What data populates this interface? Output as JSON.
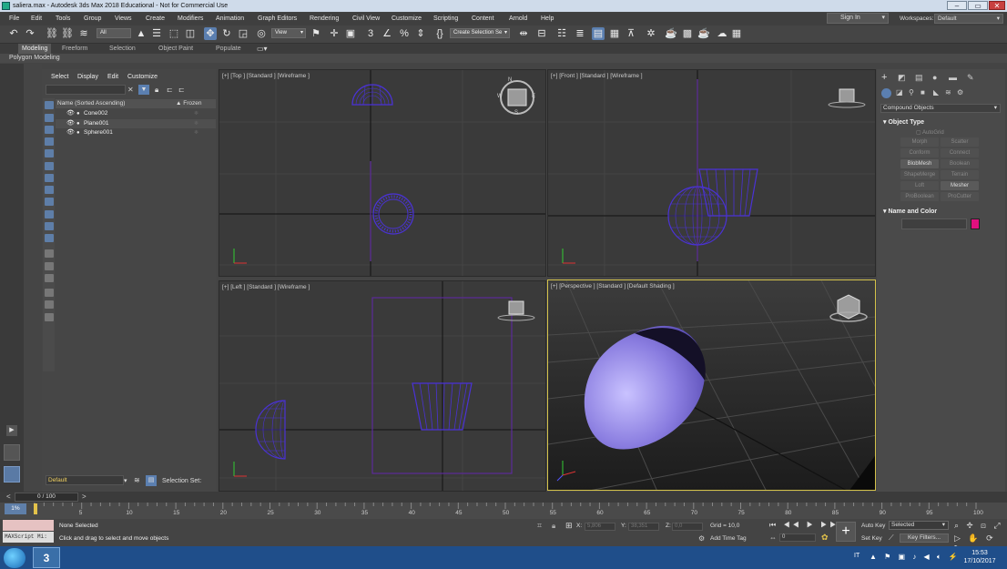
{
  "window": {
    "title": "saliera.max - Autodesk 3ds Max 2018 Educational - Not for Commercial Use"
  },
  "menu": [
    "File",
    "Edit",
    "Tools",
    "Group",
    "Views",
    "Create",
    "Modifiers",
    "Animation",
    "Graph Editors",
    "Rendering",
    "Civil View",
    "Customize",
    "Scripting",
    "Content",
    "Arnold",
    "Help"
  ],
  "account": {
    "sign_in": "Sign In",
    "workspaces_label": "Workspaces:",
    "workspace": "Default"
  },
  "toolbar": {
    "filter": "All",
    "ref_coord": "View",
    "named_set": "Create Selection Se"
  },
  "ribbon": {
    "tabs": [
      "Modeling",
      "Freeform",
      "Selection",
      "Object Paint",
      "Populate"
    ],
    "panel": "Polygon Modeling"
  },
  "explorer": {
    "menu": [
      "Select",
      "Display",
      "Edit",
      "Customize"
    ],
    "header_name": "Name (Sorted Ascending)",
    "header_frozen": "▲ Frozen",
    "objects": [
      "Cone002",
      "Plane001",
      "Sphere001"
    ],
    "layer": "Default",
    "selection_set_label": "Selection Set:"
  },
  "viewports": {
    "top": "[+] [Top ] [Standard ] [Wireframe ]",
    "front": "[+] [Front ] [Standard ] [Wireframe ]",
    "left": "[+] [Left ] [Standard ] [Wireframe ]",
    "perspective": "[+] [Perspective ] [Standard ] [Default Shading ]"
  },
  "command_panel": {
    "category": "Compound Objects",
    "object_type": "Object Type",
    "autogrid": "AutoGrid",
    "buttons": [
      "Morph",
      "Scatter",
      "Conform",
      "Connect",
      "BlobMesh",
      "Boolean",
      "ShapeMerge",
      "Terrain",
      "Loft",
      "Mesher",
      "ProBoolean",
      "ProCutter"
    ],
    "enabled": [
      "BlobMesh",
      "Mesher"
    ],
    "name_and_color": "Name and Color",
    "object_color": "#e0107e"
  },
  "timeline": {
    "frame": "0 / 100",
    "ticks": [
      "5",
      "10",
      "15",
      "20",
      "25",
      "30",
      "35",
      "40",
      "45",
      "50",
      "55",
      "60",
      "65",
      "70",
      "75",
      "80",
      "85",
      "90",
      "95",
      "100"
    ],
    "badge": "1%"
  },
  "status": {
    "selection": "None Selected",
    "prompt": "Click and drag to select and move objects",
    "maxscript": "MAXScript Mi:",
    "x_label": "X:",
    "x_value": "5,806",
    "y_label": "Y:",
    "y_value": "38,351",
    "z_label": "Z:",
    "z_value": "0,0",
    "grid": "Grid = 10,0",
    "add_time_tag": "Add Time Tag",
    "frame_spinner": "0",
    "auto_key": "Auto Key",
    "selected": "Selected",
    "set_key": "Set Key",
    "key_filters": "Key Filters..."
  },
  "taskbar": {
    "lang": "IT",
    "time": "15:53",
    "date": "17/10/2017"
  },
  "colors": {
    "wire": "#4a32d6",
    "accent": "#5b7fb0",
    "object": "#8a7de0"
  }
}
